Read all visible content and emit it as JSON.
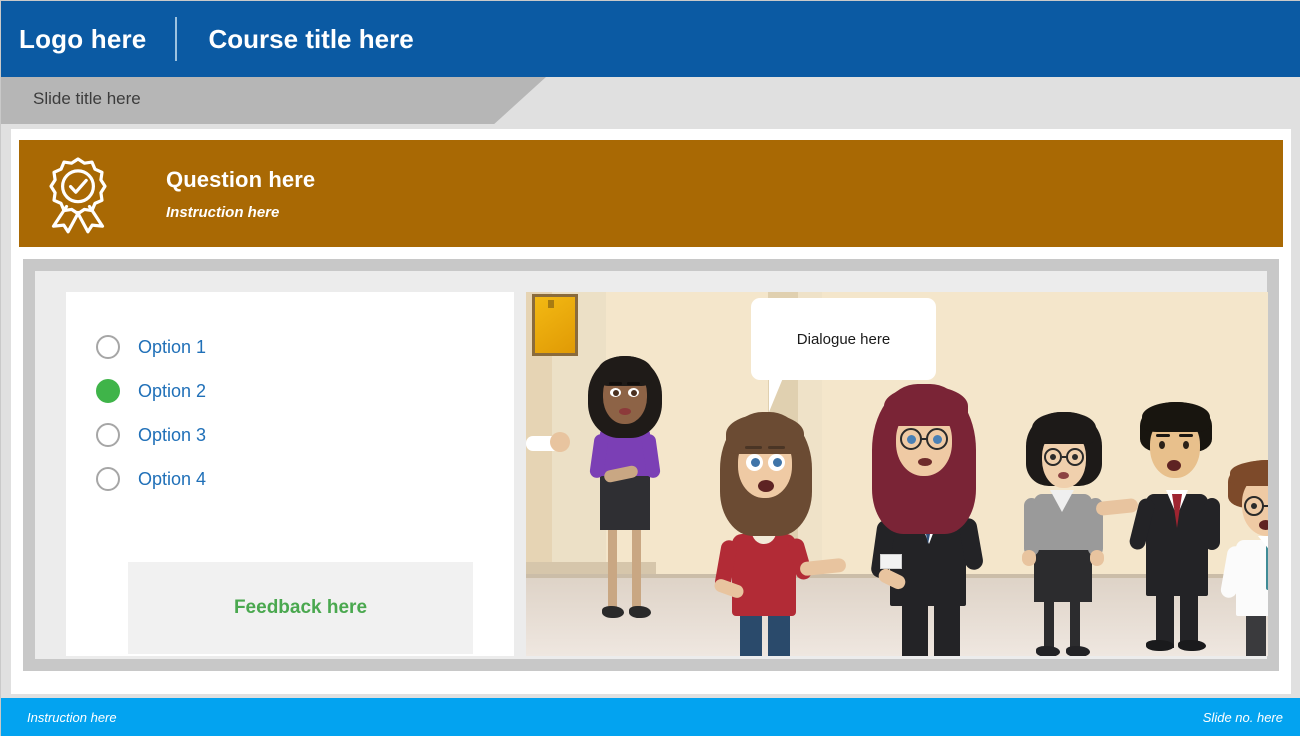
{
  "header": {
    "logo_label": "Logo here",
    "course_title": "Course title here",
    "background_color": "#0b5aa3"
  },
  "title_bar": {
    "slide_title": "Slide title here",
    "band_color": "#b6b6b6"
  },
  "banner": {
    "question": "Question here",
    "instruction": "Instruction here",
    "background_color": "#a96904",
    "icon": "award-ribbon-icon"
  },
  "quiz": {
    "options": [
      {
        "label": "Option 1",
        "selected": false
      },
      {
        "label": "Option 2",
        "selected": true
      },
      {
        "label": "Option 3",
        "selected": false
      },
      {
        "label": "Option 4",
        "selected": false
      }
    ],
    "option_text_color": "#2070b8",
    "selected_color": "#3fb449",
    "feedback": "Feedback here",
    "feedback_color": "#4aa84f"
  },
  "illustration": {
    "dialogue": "Dialogue here",
    "scene": "office-group-of-seven-characters"
  },
  "footer": {
    "instruction": "Instruction here",
    "slide_number": "Slide no. here",
    "background_color": "#03a3f0"
  }
}
